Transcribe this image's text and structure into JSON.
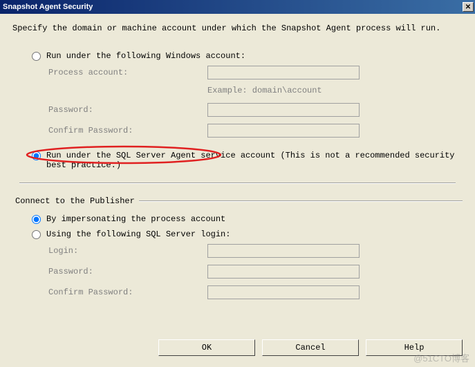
{
  "title": "Snapshot Agent Security",
  "instruction": "Specify the domain or machine account under which the Snapshot Agent process will run.",
  "windows_account": {
    "radio_label": "Run under the following Windows account:",
    "process_label": "Process account:",
    "example": "Example: domain\\account",
    "password_label": "Password:",
    "confirm_label": "Confirm Password:"
  },
  "sql_agent": {
    "radio_label": "Run under the SQL Server Agent service account (This is not a recommended security best practice.)"
  },
  "publisher": {
    "legend": "Connect to the Publisher",
    "impersonate_label": "By impersonating the process account",
    "sql_login_label": "Using the following SQL Server login:",
    "login_label": "Login:",
    "password_label": "Password:",
    "confirm_label": "Confirm Password:"
  },
  "buttons": {
    "ok": "OK",
    "cancel": "Cancel",
    "help": "Help"
  },
  "watermark": "@51CTO博客"
}
